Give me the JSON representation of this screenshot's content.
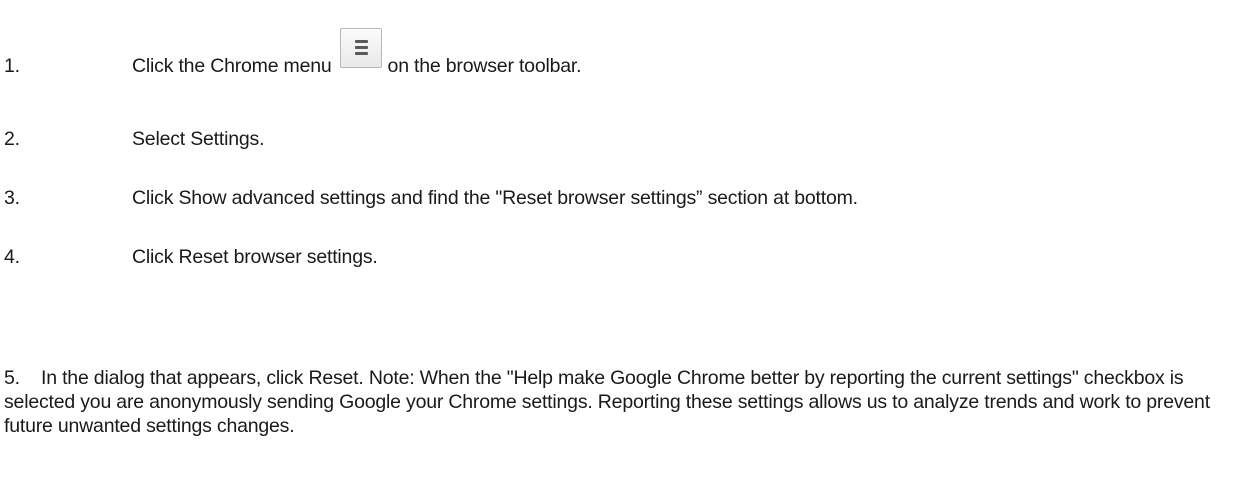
{
  "steps": [
    {
      "number": "1.",
      "text_before": "Click the Chrome menu",
      "icon": "hamburger-menu-icon",
      "text_after": "on the browser toolbar."
    },
    {
      "number": "2.",
      "text": "Select Settings."
    },
    {
      "number": "3.",
      "text": "Click Show advanced settings and find the \"Reset browser settings” section at bottom."
    },
    {
      "number": "4.",
      "text": "Click Reset browser settings."
    },
    {
      "number": "5.",
      "text": "In the dialog that appears, click Reset. Note: When the \"Help make Google Chrome better by reporting the current settings\" checkbox is selected you are anonymously sending Google your Chrome settings. Reporting these settings allows us to analyze trends and work to prevent future unwanted settings changes."
    }
  ]
}
